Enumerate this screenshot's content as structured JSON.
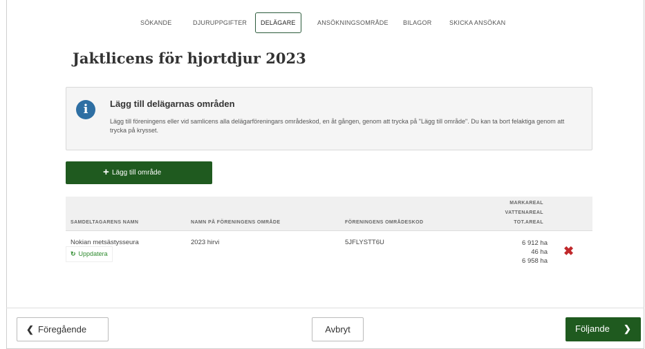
{
  "tabs": [
    {
      "label": "SÖKANDE",
      "active": false
    },
    {
      "label": "DJURUPPGIFTER",
      "active": false
    },
    {
      "label": "DELÄGARE",
      "active": true
    },
    {
      "label": "ANSÖKNINGSOMRÅDE",
      "active": false
    },
    {
      "label": "BILAGOR",
      "active": false
    },
    {
      "label": "SKICKA ANSÖKAN",
      "active": false
    }
  ],
  "page_title": "Jaktlicens för hjortdjur 2023",
  "info": {
    "icon": "info-icon",
    "title": "Lägg till delägarnas områden",
    "text": "Lägg till föreningens eller vid samlicens alla delägarföreningars områdeskod, en åt gången, genom att trycka på \"Lägg till område\". Du kan ta bort felaktiga genom att trycka på krysset."
  },
  "add_button": {
    "icon": "plus-icon",
    "label": "Lägg till område"
  },
  "table": {
    "columns": {
      "name": "SAMDELTAGARENS NAMN",
      "area_name": "NAMN PÅ FÖRENINGENS OMRÅDE",
      "area_code": "FÖRENINGENS OMRÅDESKOD",
      "land_area": "MARKAREAL",
      "water_area": "VATTENAREAL",
      "total_area": "TOT.AREAL"
    },
    "rows": [
      {
        "name": "Nokian metsästysseura",
        "area_name": "2023 hirvi",
        "area_code": "5JFLYSTT6U",
        "land_area": "6 912 ha",
        "water_area": "46 ha",
        "total_area": "6 958 ha",
        "update_label": "Uppdatera",
        "update_icon": "refresh-icon",
        "delete_icon": "close-icon"
      }
    ]
  },
  "footer": {
    "prev_label": "Föregående",
    "cancel_label": "Avbryt",
    "next_label": "Följande"
  },
  "colors": {
    "primary_green": "#1f5a1f",
    "info_blue": "#2e6fa3",
    "delete_red": "#c0282b",
    "link_green": "#2e8b2e"
  }
}
